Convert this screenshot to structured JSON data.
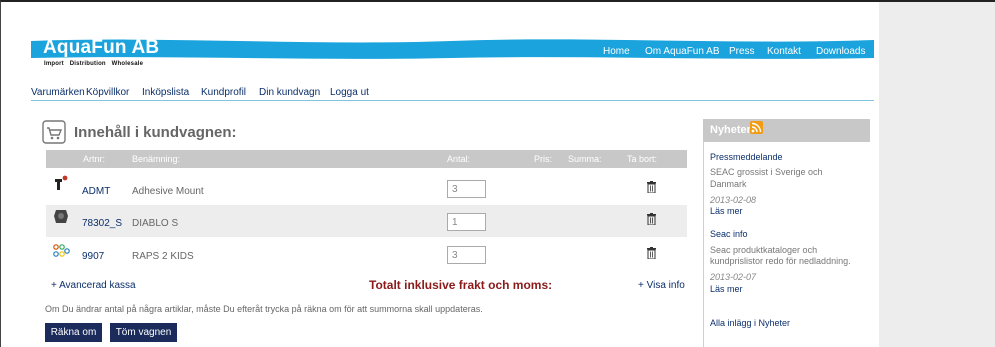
{
  "header": {
    "brand": "AquaFun AB",
    "tagline": "Import  Distribution  Wholesale",
    "nav": [
      "Home",
      "Om AquaFun AB",
      "Press",
      "Kontakt",
      "Downloads"
    ]
  },
  "subnav": [
    "Varumärken",
    "Köpvillkor",
    "Inköpslista",
    "Kundprofil",
    "Din kundvagn",
    "Logga ut"
  ],
  "cart": {
    "title": "Innehåll i kundvagnen:",
    "columns": [
      "Artnr:",
      "Benämning:",
      "Antal:",
      "Pris:",
      "Summa:",
      "Ta bort:"
    ],
    "rows": [
      {
        "artnr": "ADMT",
        "name": "Adhesive Mount",
        "qty": "3"
      },
      {
        "artnr": "78302_S",
        "name": "DIABLO S",
        "qty": "1"
      },
      {
        "artnr": "9907",
        "name": "RAPS 2 KIDS",
        "qty": "3"
      }
    ],
    "advanced_link": "+ Avancerad kassa",
    "total_label": "Totalt inklusive frakt och moms:",
    "show_info": "+ Visa info",
    "note": "Om Du ändrar antal på några artiklar, måste Du efteråt trycka på räkna om för att summorna skall uppdateras.",
    "recalc_button": "Räkna om",
    "empty_button": "Töm vagnen"
  },
  "news": {
    "title": "Nyheter",
    "items": [
      {
        "title": "Pressmeddelande",
        "text": [
          "SEAC grossist i Sverige och",
          "Danmark"
        ],
        "date": "2013-02-08",
        "more": "Läs mer"
      },
      {
        "title": "Seac info",
        "text": [
          "Seac produktkataloger och",
          "kundprislistor redo för nedladdning."
        ],
        "date": "2013-02-07",
        "more": "Läs mer"
      }
    ],
    "all_link": "Alla inlägg i Nyheter"
  },
  "colors": {
    "header_blue": "#1aa3dc",
    "nav_text": "#0b2f6b",
    "total_text": "#8b1a1a",
    "button_bg": "#1a2b5c",
    "table_header": "#c8c8c8"
  }
}
